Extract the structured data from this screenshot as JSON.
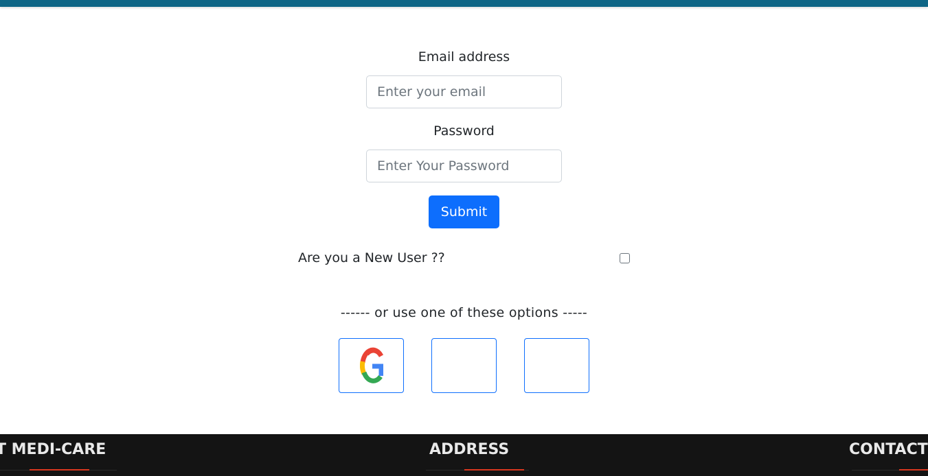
{
  "form": {
    "email_label": "Email address",
    "email_placeholder": "Enter your email",
    "email_value": "",
    "password_label": "Password",
    "password_placeholder": "Enter Your Password",
    "password_value": "",
    "submit_label": "Submit",
    "new_user_label": "Are you a New User ??",
    "new_user_checked": false
  },
  "social": {
    "divider_text": "------ or use one of these options -----",
    "options": [
      {
        "icon": "google-icon"
      },
      {
        "icon": ""
      },
      {
        "icon": ""
      }
    ]
  },
  "footer": {
    "about_title": "T MEDI-CARE",
    "address_title": "ADDRESS",
    "contact_title": "CONTACT"
  },
  "colors": {
    "top_bar": "#0e6585",
    "primary": "#0d6efd",
    "footer_bg": "#141414",
    "footer_accent": "#d9371f"
  }
}
